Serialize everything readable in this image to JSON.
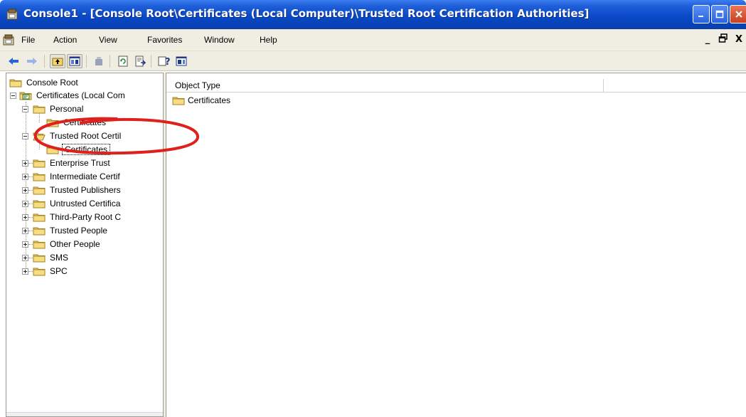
{
  "window": {
    "title": "Console1 - [Console Root\\Certificates (Local Computer)\\Trusted Root Certification Authorities]",
    "controls": [
      "minimize",
      "maximize",
      "close"
    ]
  },
  "menu": {
    "items": [
      "File",
      "Action",
      "View",
      "Favorites",
      "Window",
      "Help"
    ],
    "mdi_controls": [
      "_",
      "❐",
      "X"
    ]
  },
  "toolbar": {
    "icons": [
      "back-arrow-icon",
      "forward-arrow-icon",
      "up-one-level-icon",
      "show-hide-tree-icon",
      "delete-icon",
      "refresh-icon",
      "export-list-icon",
      "help-icon",
      "show-hide-action-pane-icon"
    ]
  },
  "tree": {
    "items": [
      {
        "label": "Console Root",
        "level": 0
      },
      {
        "label": "Certificates (Local Com",
        "level": 1,
        "expanded": true
      },
      {
        "label": "Personal",
        "level": 2,
        "expanded": true
      },
      {
        "label": "Certificates",
        "level": 3
      },
      {
        "label": "Trusted Root Certil",
        "level": 2,
        "expanded": true,
        "open": true
      },
      {
        "label": "Certificates",
        "level": 3,
        "selected": true
      },
      {
        "label": "Enterprise Trust",
        "level": 2
      },
      {
        "label": "Intermediate Certif",
        "level": 2
      },
      {
        "label": "Trusted Publishers",
        "level": 2
      },
      {
        "label": "Untrusted Certifica",
        "level": 2
      },
      {
        "label": "Third-Party Root C",
        "level": 2
      },
      {
        "label": "Trusted People",
        "level": 2
      },
      {
        "label": "Other People",
        "level": 2
      },
      {
        "label": "SMS",
        "level": 2
      },
      {
        "label": "SPC",
        "level": 2
      }
    ]
  },
  "list": {
    "column_header": "Object Type",
    "items": [
      "Certificates"
    ]
  },
  "colors": {
    "titlebar": "#0a49c9",
    "chrome": "#f0eee2",
    "folder": "#f5d36b",
    "annotation": "#e0201c"
  }
}
